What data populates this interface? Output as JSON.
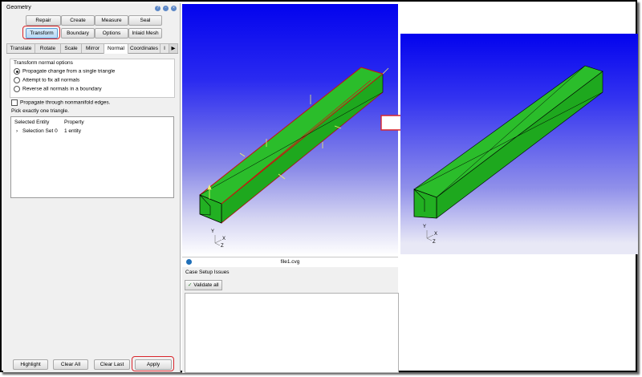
{
  "panel": {
    "title": "Geometry",
    "title_icons": [
      "help-icon",
      "float-icon",
      "close-icon"
    ],
    "row1": [
      "Repair",
      "Create",
      "Measure",
      "Seal"
    ],
    "row2": [
      "Transform",
      "Boundary",
      "Options",
      "Inlaid Mesh"
    ],
    "active_button": "Transform",
    "tabs": [
      "Translate",
      "Rotate",
      "Scale",
      "Mirror",
      "Normal",
      "Coordinates",
      "I"
    ],
    "active_tab": "Normal",
    "group_label": "Transform normal options",
    "radios": [
      {
        "label": "Propagate change from a single triangle",
        "checked": true
      },
      {
        "label": "Attempt to fix all normals",
        "checked": false
      },
      {
        "label": "Reverse all normals in a boundary",
        "checked": false
      }
    ],
    "checkbox_label": "Propagate through nonmanifold edges.",
    "hint": "Pick exactly one triangle.",
    "table": {
      "headers": [
        "Selected Entity",
        "Property"
      ],
      "rows": [
        {
          "entity": "Selection Set 0",
          "property": "1 entity"
        }
      ]
    },
    "footer_buttons": [
      "Highlight",
      "Clear All",
      "Clear Last",
      "Apply"
    ]
  },
  "viewport": {
    "file_name": "file1.cvg",
    "axes": [
      "Y",
      "X",
      "Z"
    ]
  },
  "issues": {
    "title": "Case Setup Issues",
    "validate_label": "Validate all"
  },
  "colors": {
    "highlight": "#d9262c",
    "mesh_green": "#23b323",
    "viewport_blue": "#0303ee"
  }
}
